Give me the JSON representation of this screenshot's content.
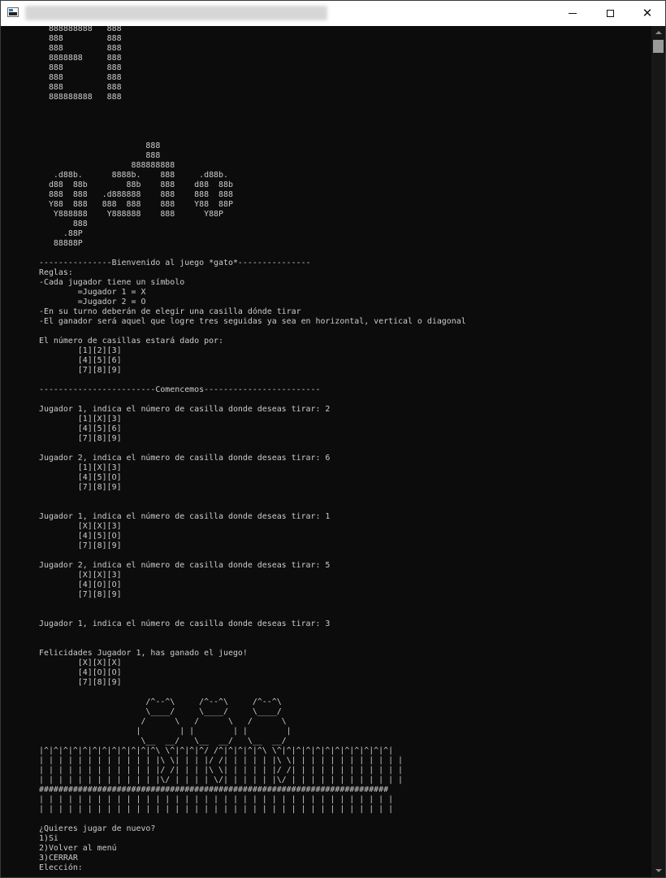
{
  "window": {
    "title": "",
    "controls": {
      "minimize": "minimize-icon",
      "maximize": "maximize-icon",
      "close": "close-icon",
      "close_glyph": "✕"
    }
  },
  "console": {
    "text": "  888888888   888\n  888         888\n  888         888\n  8888888     888\n  888         888\n  888         888\n  888         888\n  888888888   888\n\n\n\n\n                      888\n                      888\n                   888888888\n   .d88b.      8888b.    888     .d88b.\n  d88  88b        88b    888    d88  88b\n  888  888   .d888888    888    888  888\n  Y88  888   888  888    888    Y88  88P\n   Y888888    Y888888    888      Y88P\n       888\n     .88P\n   88888P\n\n---------------Bienvenido al juego *gato*---------------\nReglas:\n-Cada jugador tiene un símbolo\n        =Jugador 1 = X\n        =Jugador 2 = O\n-En su turno deberán de elegir una casilla dónde tirar\n-El ganador será aquel que logre tres seguidas ya sea en horizontal, vertical o diagonal\n\nEl número de casillas estará dado por:\n        [1][2][3]\n        [4][5][6]\n        [7][8][9]\n\n------------------------Comencemos------------------------\n\nJugador 1, indica el número de casilla donde deseas tirar: 2\n        [1][X][3]\n        [4][5][6]\n        [7][8][9]\n\nJugador 2, indica el número de casilla donde deseas tirar: 6\n        [1][X][3]\n        [4][5][O]\n        [7][8][9]\n\n\nJugador 1, indica el número de casilla donde deseas tirar: 1\n        [X][X][3]\n        [4][5][O]\n        [7][8][9]\n\nJugador 2, indica el número de casilla donde deseas tirar: 5\n        [X][X][3]\n        [4][O][O]\n        [7][8][9]\n\n\nJugador 1, indica el número de casilla donde deseas tirar: 3\n\n\nFelicidades Jugador 1, has ganado el juego!\n        [X][X][X]\n        [4][O][O]\n        [7][8][9]\n\n                      /^--^\\     /^--^\\     /^--^\\\n                      \\____/     \\____/     \\____/\n                     /      \\   /      \\   /      \\\n                    |        | |        | |        |\n                     \\__  __/   \\__  __/   \\__  __/\n|^|^|^|^|^|^|^|^|^|^|^|^\\ \\^|^|^|^/ /^|^|^|^|^\\ \\^|^|^|^|^|^|^|^|^|^|^|^|\n| | | | | | | | | | | | |\\ \\| | | |/ /| | | | | |\\ \\| | | | | | | | | | | |\n| | | | | | | | | | | | |/ /| | | |\\ \\| | | | | |/ /| | | | | | | | | | | |\n| | | | | | | | | | | | |\\/ | | | | \\/| | | | | |\\/ | | | | | | | | | | | |\n########################################################################\n| | | | | | | | | | | | | | | | | | | | | | | | | | | | | | | | | | | | |\n| | | | | | | | | | | | | | | | | | | | | | | | | | | | | | | | | | | | |\n\n¿Quieres jugar de nuevo?\n1)Si\n2)Volver al menú\n3)CERRAR\nElección:"
  },
  "scrollbar": {
    "up": "scroll-up-arrow",
    "down": "scroll-down-arrow"
  },
  "colors": {
    "background": "#0c0c0c",
    "foreground": "#cccccc",
    "titlebar": "#ffffff"
  }
}
